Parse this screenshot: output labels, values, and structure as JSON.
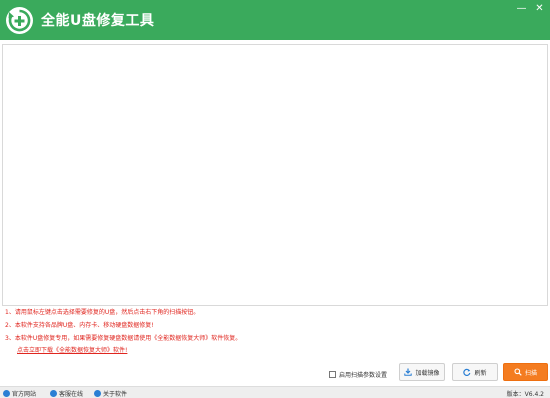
{
  "app": {
    "title": "全能U盘修复工具"
  },
  "window_controls": {
    "minimize": "—",
    "close": "✕"
  },
  "notes": [
    "1、请用鼠标左键点击选择需要修复的U盘，然后点击右下角的扫描按钮。",
    "2、本软件支持各品牌U盘、内存卡、移动硬盘数据修复!",
    "3、本软件U盘修复专用，如果需要修复硬盘数据请使用《全能数据恢复大师》软件恢复。",
    "点击立即下载《全能数据恢复大师》软件!"
  ],
  "options": {
    "scan_settings_label": "启用扫描参数设置",
    "scan_settings_checked": false
  },
  "buttons": {
    "load_image": "加载镜像",
    "refresh": "刷新",
    "scan": "扫描"
  },
  "statusbar": {
    "links": [
      "官方网站",
      "客服在线",
      "关于软件"
    ],
    "version": "版本：V6.4.2"
  },
  "colors": {
    "title_bar": "#3aaa5c",
    "accent": "#f47c20",
    "note_text": "#e0261f"
  },
  "icons": [
    "usb-repair-logo",
    "download-icon",
    "refresh-icon",
    "search-icon",
    "home-icon",
    "chat-icon",
    "info-icon"
  ]
}
